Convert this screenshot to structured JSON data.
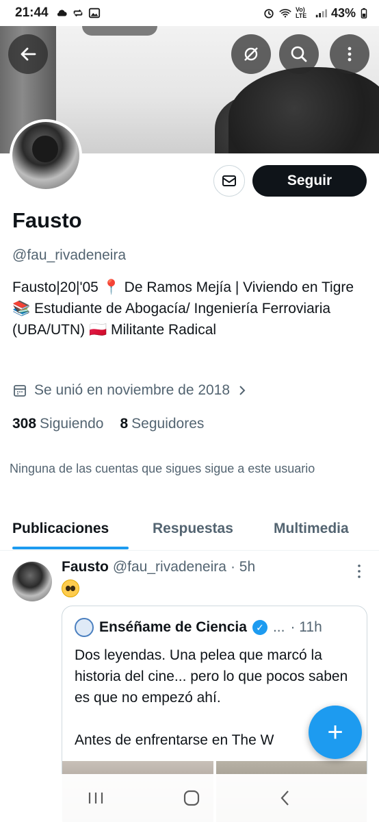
{
  "status_bar": {
    "time": "21:44",
    "battery": "43%",
    "network": "Vo) LTE"
  },
  "profile": {
    "name": "Fausto",
    "handle": "@fau_rivadeneira",
    "bio": "Fausto|20|'05 📍 De Ramos Mejía | Viviendo en Tigre 📚 Estudiante de Abogacía/ Ingeniería Ferroviaria (UBA/UTN) 🇵🇱 Militante Radical",
    "joined": "Se unió en noviembre de 2018",
    "following_count": "308",
    "following_label": "Siguiendo",
    "followers_count": "8",
    "followers_label": "Seguidores",
    "mutual_note": "Ninguna de las cuentas que sigues sigue a este usuario"
  },
  "actions": {
    "follow_label": "Seguir"
  },
  "tabs": [
    {
      "label": "Publicaciones",
      "active": true
    },
    {
      "label": "Respuestas",
      "active": false
    },
    {
      "label": "Multimedia",
      "active": false
    }
  ],
  "tweet": {
    "name": "Fausto",
    "handle": "@fau_rivadeneira",
    "time": "· 5h",
    "emoji": "🥺",
    "quote": {
      "name": "Enséñame de Ciencia",
      "ellipsis": "...",
      "time": "· 11h",
      "text_line1": "Dos leyendas. Una pelea que marcó la historia del cine... pero lo que pocos saben es que no empezó ahí.",
      "text_line2": "Antes de enfrentarse en The W"
    }
  },
  "fab": {
    "label": "+"
  },
  "colors": {
    "accent": "#1d9bf0",
    "text_primary": "#0f1419",
    "text_secondary": "#536471"
  }
}
